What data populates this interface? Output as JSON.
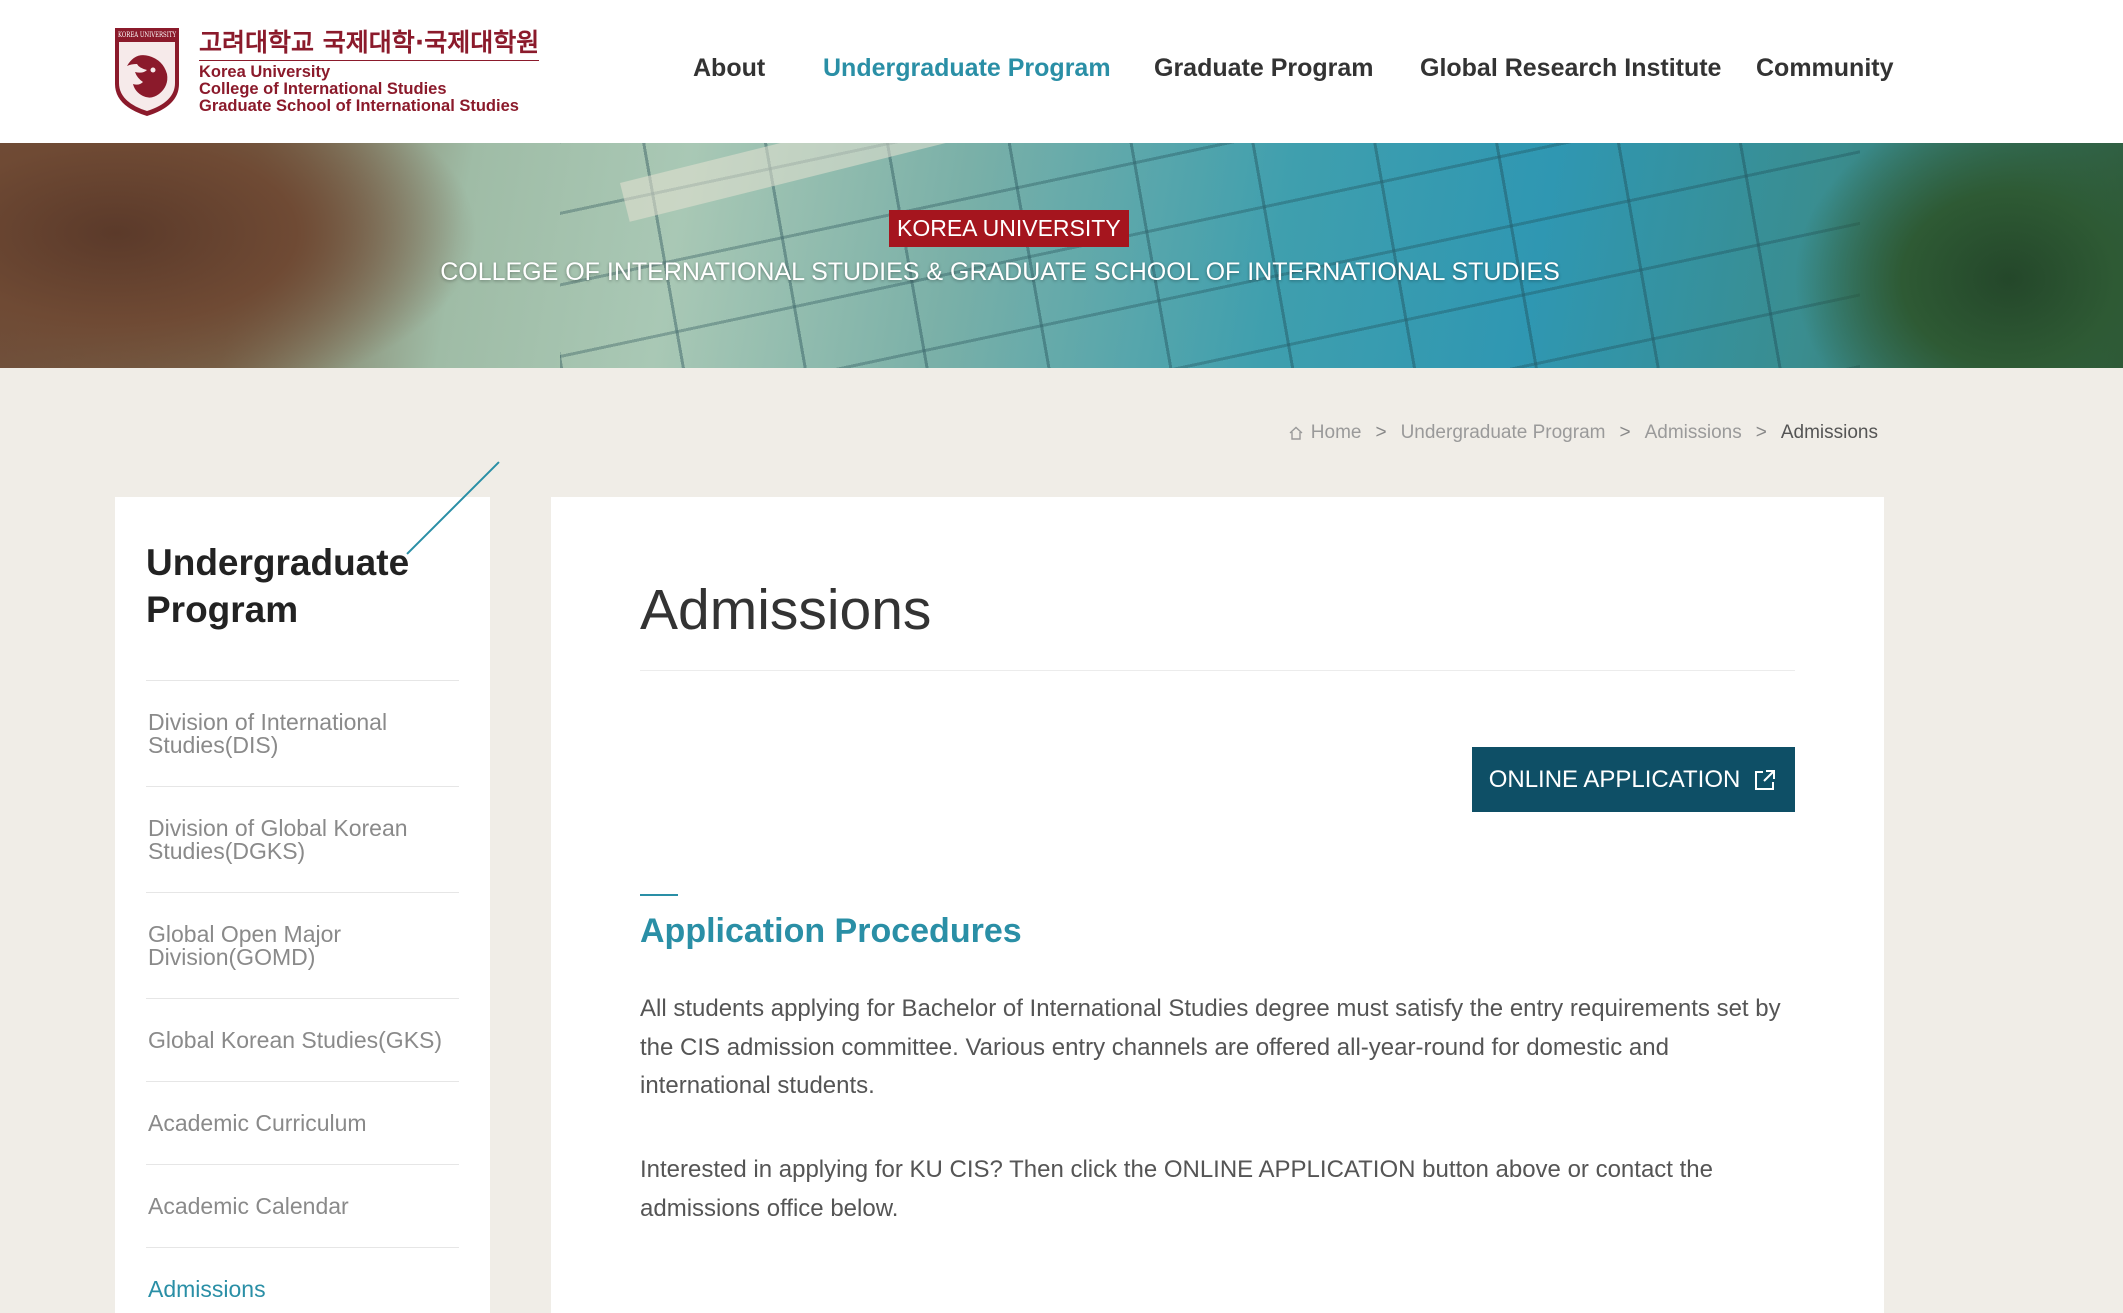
{
  "header": {
    "logo": {
      "emblem_text": "KOREA UNIVERSITY",
      "korean_title": "고려대학교 국제대학·국제대학원",
      "line1": "Korea University",
      "line2": "College of International Studies",
      "line3": "Graduate School of International Studies"
    },
    "nav": [
      {
        "label": "About"
      },
      {
        "label": "Undergraduate Program"
      },
      {
        "label": "Graduate Program"
      },
      {
        "label": "Global Research Institute"
      },
      {
        "label": "Community"
      }
    ]
  },
  "banner": {
    "badge": "KOREA UNIVERSITY",
    "subtitle": "COLLEGE OF INTERNATIONAL STUDIES & GRADUATE SCHOOL OF INTERNATIONAL STUDIES"
  },
  "breadcrumb": {
    "items": [
      "Home",
      "Undergraduate Program",
      "Admissions",
      "Admissions"
    ],
    "separator": ">"
  },
  "sidebar": {
    "title": "Undergraduate Program",
    "items": [
      {
        "label": "Division of International Studies(DIS)"
      },
      {
        "label": "Division of Global Korean Studies(DGKS)"
      },
      {
        "label": "Global Open Major Division(GOMD)"
      },
      {
        "label": "Global Korean Studies(GKS)"
      },
      {
        "label": "Academic Curriculum"
      },
      {
        "label": "Academic Calendar"
      },
      {
        "label": "Admissions"
      }
    ]
  },
  "content": {
    "title": "Admissions",
    "online_button": "ONLINE APPLICATION",
    "section_title": "Application Procedures",
    "para1": "All students applying for Bachelor of International Studies degree must satisfy the entry requirements set by the CIS admission committee. Various entry channels are offered all-year-round for domestic and international students.",
    "para2": "Interested in applying for KU CIS? Then click the ONLINE APPLICATION button above or contact the admissions office below."
  },
  "colors": {
    "brand": "#8b1a2b",
    "accent": "#2a8fa6",
    "button": "#0e4f66",
    "badge": "#a5151e"
  }
}
